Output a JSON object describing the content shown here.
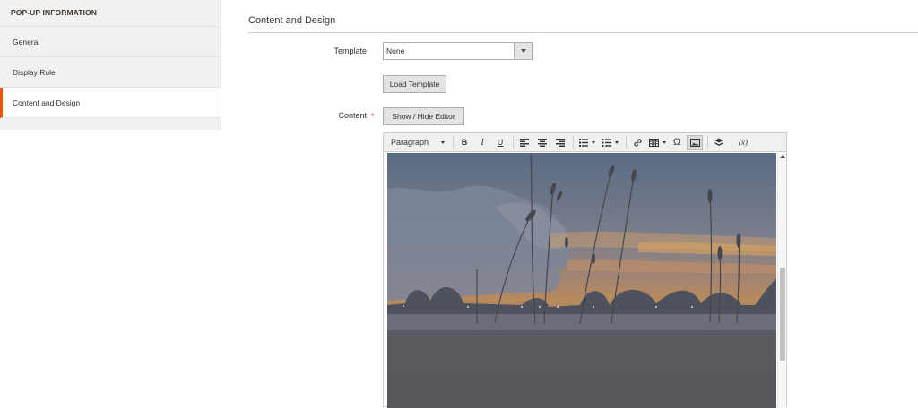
{
  "sidebar": {
    "title": "POP-UP INFORMATION",
    "items": [
      {
        "label": "General"
      },
      {
        "label": "Display Rule"
      },
      {
        "label": "Content and Design"
      }
    ],
    "active_color": "#eb5202"
  },
  "main": {
    "section_title": "Content and Design",
    "template": {
      "label": "Template",
      "value": "None",
      "load_button": "Load Template"
    },
    "content": {
      "label": "Content",
      "required_mark": "*",
      "toggle_button": "Show / Hide Editor"
    },
    "editor": {
      "toolbar": {
        "format_value": "Paragraph",
        "buttons": [
          {
            "name": "bold-icon",
            "glyph": "B"
          },
          {
            "name": "italic-icon",
            "glyph": "I"
          },
          {
            "name": "underline-icon",
            "glyph": "U"
          },
          {
            "name": "align-left-icon"
          },
          {
            "name": "align-center-icon"
          },
          {
            "name": "align-right-icon"
          },
          {
            "name": "bullet-list-icon"
          },
          {
            "name": "numbered-list-icon"
          },
          {
            "name": "link-icon"
          },
          {
            "name": "table-icon"
          },
          {
            "name": "special-character-icon",
            "glyph": "Ω"
          },
          {
            "name": "insert-image-icon"
          },
          {
            "name": "widget-icon"
          },
          {
            "name": "variable-icon",
            "glyph": "(x)"
          }
        ]
      },
      "content_image": "sunset-landscape-with-reeds-and-clouds"
    }
  }
}
